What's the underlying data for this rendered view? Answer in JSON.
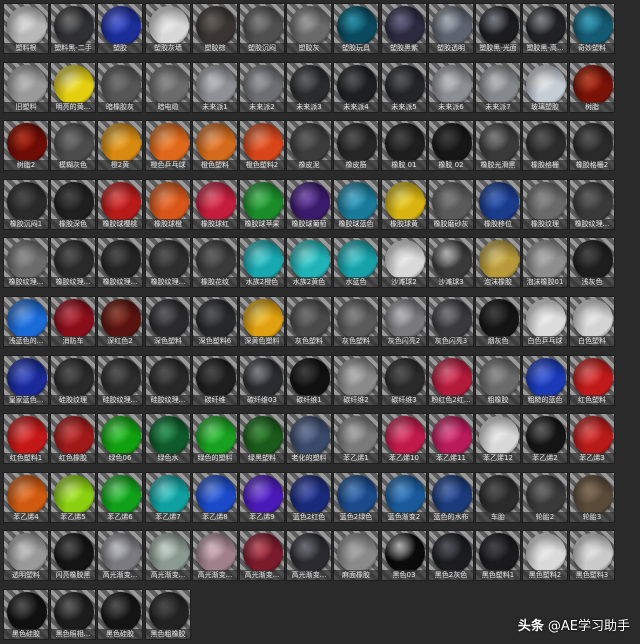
{
  "watermark": {
    "brand": "头条",
    "account": "@AE学习助手"
  },
  "materials": [
    {
      "label": "塑料根",
      "color": "#b8b8b8",
      "hl": "#ffffff"
    },
    {
      "label": "塑料黑-二手",
      "color": "#2f3032",
      "hl": "#8a8a8a"
    },
    {
      "label": "塑胶",
      "color": "#1c2e9a",
      "hl": "#6f82ff"
    },
    {
      "label": "塑胶灰墙",
      "color": "#d8d8d8",
      "hl": "#ffffff"
    },
    {
      "label": "塑胶棕",
      "color": "#3a3532",
      "hl": "#7d7570"
    },
    {
      "label": "塑胶沉闷",
      "color": "#505050",
      "hl": "#a0a0a0"
    },
    {
      "label": "塑胶灰",
      "color": "#6a6a6a",
      "hl": "#c0c0c0"
    },
    {
      "label": "塑胶玩具",
      "color": "#0b4a5e",
      "hl": "#3ab6d2"
    },
    {
      "label": "塑胶黑紫",
      "color": "#2b2a3e",
      "hl": "#8582a8"
    },
    {
      "label": "塑胶透明",
      "color": "#5d6470",
      "hl": "#cfd6e0"
    },
    {
      "label": "塑胶黑-光面",
      "color": "#1a1c1e",
      "hl": "#9aa0a8"
    },
    {
      "label": "塑胶黑-高...",
      "color": "#202224",
      "hl": "#a5a8ac"
    },
    {
      "label": "奇妙塑料",
      "color": "#155a73",
      "hl": "#4cc6e6"
    },
    {
      "label": "旧塑料",
      "color": "#9a9a9a",
      "hl": "#dadada"
    },
    {
      "label": "明亮的黄...",
      "color": "#e3cf10",
      "hl": "#fff5a0"
    },
    {
      "label": "暗橡胶灰",
      "color": "#565656",
      "hl": "#8c8c8c"
    },
    {
      "label": "暗电缆",
      "color": "#6b6b6b",
      "hl": "#a8a8a8"
    },
    {
      "label": "未来派1",
      "color": "#8e9095",
      "hl": "#dfe2e6"
    },
    {
      "label": "未来派2",
      "color": "#6c6e72",
      "hl": "#bfc2c6"
    },
    {
      "label": "未来派3",
      "color": "#2a2b2d",
      "hl": "#7a7c80"
    },
    {
      "label": "未来派4",
      "color": "#1e1f21",
      "hl": "#6a6c70"
    },
    {
      "label": "未来派5",
      "color": "#242527",
      "hl": "#6e7073"
    },
    {
      "label": "未来派6",
      "color": "#8b8e92",
      "hl": "#e6e8ea"
    },
    {
      "label": "未来派7",
      "color": "#85888c",
      "hl": "#e0e2e4"
    },
    {
      "label": "玻璃塑胶",
      "color": "#c4ccd4",
      "hl": "#ffffff"
    },
    {
      "label": "树脂",
      "color": "#7a1208",
      "hl": "#e25a3a"
    },
    {
      "label": "树脂2",
      "color": "#6e0c06",
      "hl": "#d8442a"
    },
    {
      "label": "模糊灰色",
      "color": "#4c4c4c",
      "hl": "#8e8e8e"
    },
    {
      "label": "橙2黄",
      "color": "#d88a10",
      "hl": "#ffd070"
    },
    {
      "label": "橙色乒乓球",
      "color": "#e0681a",
      "hl": "#ffb070"
    },
    {
      "label": "橙色塑料",
      "color": "#d46a1c",
      "hl": "#ffb47a"
    },
    {
      "label": "橙色塑料2",
      "color": "#d8451a",
      "hl": "#ff9a70"
    },
    {
      "label": "橡皮泥",
      "color": "#3c3c3c",
      "hl": "#7a7a7a"
    },
    {
      "label": "橡皮筋",
      "color": "#262626",
      "hl": "#6a6a6a"
    },
    {
      "label": "橡胶 01",
      "color": "#1e1e1e",
      "hl": "#5a5a5a"
    },
    {
      "label": "橡胶 02",
      "color": "#161616",
      "hl": "#4e4e4e"
    },
    {
      "label": "橡胶光滑黑",
      "color": "#3a3a3a",
      "hl": "#a0a0a0"
    },
    {
      "label": "橡胶格栅",
      "color": "#2c2c2c",
      "hl": "#707070"
    },
    {
      "label": "橡胶格栅2",
      "color": "#2a2a2a",
      "hl": "#6e6e6e"
    },
    {
      "label": "橡胶沉闷1",
      "color": "#2a2a2a",
      "hl": "#5e5e5e"
    },
    {
      "label": "橡胶深色",
      "color": "#1f1f1f",
      "hl": "#5a5a5a"
    },
    {
      "label": "橡胶球樱桃",
      "color": "#b81a1a",
      "hl": "#ff7070"
    },
    {
      "label": "橡胶球橙",
      "color": "#d8561a",
      "hl": "#ff9d66"
    },
    {
      "label": "橡胶球红",
      "color": "#c41c3c",
      "hl": "#ff7a90"
    },
    {
      "label": "橡胶球苹果",
      "color": "#1a8c2a",
      "hl": "#70e080"
    },
    {
      "label": "橡胶球葡萄",
      "color": "#3a1a6a",
      "hl": "#9a70d8"
    },
    {
      "label": "橡胶球蓝色",
      "color": "#1a7a9a",
      "hl": "#70d0f0"
    },
    {
      "label": "橡胶球黄",
      "color": "#d8b410",
      "hl": "#fff070"
    },
    {
      "label": "橡胶磨砂灰",
      "color": "#5a5a5a",
      "hl": "#9a9a9a"
    },
    {
      "label": "橡胶移位",
      "color": "#1a3a8a",
      "hl": "#5a86e0"
    },
    {
      "label": "橡胶纹理",
      "color": "#6a6a6a",
      "hl": "#aaaaaa"
    },
    {
      "label": "橡胶纹理...",
      "color": "#3a3a3a",
      "hl": "#7a7a7a"
    },
    {
      "label": "橡胶纹理...",
      "color": "#6c6c6c",
      "hl": "#b0b0b0"
    },
    {
      "label": "橡胶纹理...",
      "color": "#2a2a2a",
      "hl": "#6a6a6a"
    },
    {
      "label": "橡胶纹理...",
      "color": "#242424",
      "hl": "#646464"
    },
    {
      "label": "橡胶纹理...",
      "color": "#2e2e2e",
      "hl": "#6e6e6e"
    },
    {
      "label": "橡胶花纹",
      "color": "#3a3a3a",
      "hl": "#7e7e7e"
    },
    {
      "label": "水族2橙色",
      "color": "#18a8b0",
      "hl": "#80f0f0"
    },
    {
      "label": "水族2黄色",
      "color": "#20b4b8",
      "hl": "#90f4f0"
    },
    {
      "label": "水蓝色",
      "color": "#16a0a8",
      "hl": "#7aeaf0"
    },
    {
      "label": "沙滩球2",
      "color": "#d8d8d8",
      "hl": "#ffffff"
    },
    {
      "label": "沙滩球3",
      "color": "#3a3a3a",
      "hl": "#e0e0e0"
    },
    {
      "label": "泡沫橡胶",
      "color": "#b89a3a",
      "hl": "#f0dc90"
    },
    {
      "label": "泡沫橡胶01",
      "color": "#8e8e8e",
      "hl": "#d0d0d0"
    },
    {
      "label": "浅灰色",
      "color": "#1e1e1e",
      "hl": "#5a5a5a"
    },
    {
      "label": "浅蓝色的...",
      "color": "#1a6ad8",
      "hl": "#7ab4ff"
    },
    {
      "label": "消防车",
      "color": "#8a0e1a",
      "hl": "#e05a6a"
    },
    {
      "label": "深红色2",
      "color": "#5a1410",
      "hl": "#b05a4a"
    },
    {
      "label": "深色塑料",
      "color": "#2a2a2c",
      "hl": "#7a7a7e"
    },
    {
      "label": "深色塑料6",
      "color": "#26282a",
      "hl": "#6e7074"
    },
    {
      "label": "深黄色塑料",
      "color": "#e0a010",
      "hl": "#ffe070"
    },
    {
      "label": "灰色塑料",
      "color": "#4a4a4a",
      "hl": "#8e8e8e"
    },
    {
      "label": "灰色塑料",
      "color": "#5a5a5a",
      "hl": "#a4a4a4"
    },
    {
      "label": "灰色闪亮2",
      "color": "#7a7a7e",
      "hl": "#e0e0e4"
    },
    {
      "label": "灰色闪亮3",
      "color": "#3a3a3e",
      "hl": "#9c9ca0"
    },
    {
      "label": "烟灰色",
      "color": "#141414",
      "hl": "#525252"
    },
    {
      "label": "白色乒乓球",
      "color": "#dcdcdc",
      "hl": "#ffffff"
    },
    {
      "label": "白色塑料",
      "color": "#d4d4d4",
      "hl": "#ffffff"
    },
    {
      "label": "皇家蓝色...",
      "color": "#1a2a9a",
      "hl": "#6a80f0"
    },
    {
      "label": "硅胶纹理",
      "color": "#2a2a2a",
      "hl": "#6a6a6a"
    },
    {
      "label": "硅胶纹理...",
      "color": "#2c2c2c",
      "hl": "#6c6c6c"
    },
    {
      "label": "硅胶纹理...",
      "color": "#282828",
      "hl": "#686868"
    },
    {
      "label": "碳纤维",
      "color": "#1e1e1e",
      "hl": "#5e5e5e"
    },
    {
      "label": "碳纤维03",
      "color": "#2a2c30",
      "hl": "#a0a4aa"
    },
    {
      "label": "碳纤维1",
      "color": "#101010",
      "hl": "#505050"
    },
    {
      "label": "碳纤维2",
      "color": "#8a8a8a",
      "hl": "#dadada"
    },
    {
      "label": "碳纤维3",
      "color": "#2a2a2a",
      "hl": "#6a6a6a"
    },
    {
      "label": "粉红色2红...",
      "color": "#b41a3a",
      "hl": "#ff7a9a"
    },
    {
      "label": "粗橡胶",
      "color": "#6a6a6a",
      "hl": "#b0b0b0"
    },
    {
      "label": "粗糙的蓝色",
      "color": "#1a3ab8",
      "hl": "#6a8aff"
    },
    {
      "label": "红色塑料",
      "color": "#c01a1a",
      "hl": "#ff7a7a"
    },
    {
      "label": "红色塑料1",
      "color": "#c41818",
      "hl": "#ff7070"
    },
    {
      "label": "红色橡胶",
      "color": "#a01a1a",
      "hl": "#e86060"
    },
    {
      "label": "绿色06",
      "color": "#10a010",
      "hl": "#70f070"
    },
    {
      "label": "绿色水",
      "color": "#0e5a2a",
      "hl": "#4ac07a"
    },
    {
      "label": "绿色的塑料",
      "color": "#18a020",
      "hl": "#7af080"
    },
    {
      "label": "绿黑塑料",
      "color": "#1a5a1a",
      "hl": "#5ab05a"
    },
    {
      "label": "老化的塑料",
      "color": "#3a4a6a",
      "hl": "#8a9ac0"
    },
    {
      "label": "苯乙烯1",
      "color": "#7a7a7a",
      "hl": "#d0d0d0"
    },
    {
      "label": "苯乙烯10",
      "color": "#c01a4a",
      "hl": "#ff7aa0"
    },
    {
      "label": "苯乙烯11",
      "color": "#b81a5a",
      "hl": "#ff7ab0"
    },
    {
      "label": "苯乙烯12",
      "color": "#d8d8d8",
      "hl": "#ffffff"
    },
    {
      "label": "苯乙烯2",
      "color": "#141414",
      "hl": "#7a7a7a"
    },
    {
      "label": "苯乙烯3",
      "color": "#b81a1a",
      "hl": "#ff7070"
    },
    {
      "label": "苯乙烯4",
      "color": "#d05a10",
      "hl": "#ffa060"
    },
    {
      "label": "苯乙烯5",
      "color": "#8ad010",
      "hl": "#d8ff80"
    },
    {
      "label": "苯乙烯6",
      "color": "#10a01a",
      "hl": "#80f08a"
    },
    {
      "label": "苯乙烯7",
      "color": "#10a0a0",
      "hl": "#80f0f0"
    },
    {
      "label": "苯乙烯8",
      "color": "#1a4ac8",
      "hl": "#7aa0ff"
    },
    {
      "label": "苯乙烯9",
      "color": "#4a1ab8",
      "hl": "#a07aff"
    },
    {
      "label": "蓝色2红色",
      "color": "#1a2a7a",
      "hl": "#6a7ad0"
    },
    {
      "label": "蓝色2绿色",
      "color": "#1a4a8a",
      "hl": "#6aa0e0"
    },
    {
      "label": "蓝色渐变2",
      "color": "#1a5a9a",
      "hl": "#6ab0f0"
    },
    {
      "label": "蓝色的水布",
      "color": "#1a3a7a",
      "hl": "#6a8ad0"
    },
    {
      "label": "车胎",
      "color": "#2a2a2a",
      "hl": "#6a6a6a"
    },
    {
      "label": "轮胎2",
      "color": "#3a3a3a",
      "hl": "#8a8a8a"
    },
    {
      "label": "轮胎3",
      "color": "#5a4a3a",
      "hl": "#a08a70"
    },
    {
      "label": "透明塑料",
      "color": "#9a9a9a",
      "hl": "#e8e8e8"
    },
    {
      "label": "闪亮橡胶黑",
      "color": "#141414",
      "hl": "#6a6a6a"
    },
    {
      "label": "高光渐变...",
      "color": "#7a7a80",
      "hl": "#e8e8f0"
    },
    {
      "label": "高光渐变...",
      "color": "#8a9a90",
      "hl": "#f0fff4"
    },
    {
      "label": "高光渐变...",
      "color": "#a0808a",
      "hl": "#ffe0ea"
    },
    {
      "label": "高光渐变...",
      "color": "#7a1a2a",
      "hl": "#e87080"
    },
    {
      "label": "高光渐变...",
      "color": "#2a2a30",
      "hl": "#8a8a96"
    },
    {
      "label": "麻面橡胶",
      "color": "#8a8a8a",
      "hl": "#c8c8c8"
    },
    {
      "label": "黑色03",
      "color": "#0a0a0a",
      "hl": "#e0e0e0"
    },
    {
      "label": "黑色2灰色",
      "color": "#1a1c20",
      "hl": "#6a6e76"
    },
    {
      "label": "黑色塑料1",
      "color": "#1a1a1c",
      "hl": "#5a5a5e"
    },
    {
      "label": "黑色塑料2",
      "color": "#dadada",
      "hl": "#ffffff"
    },
    {
      "label": "黑色塑料3",
      "color": "#cacaca",
      "hl": "#ffffff"
    },
    {
      "label": "黑色硅胶",
      "color": "#101010",
      "hl": "#6a6a6a"
    },
    {
      "label": "黑色照相...",
      "color": "#1c1c1c",
      "hl": "#7a7a7a"
    },
    {
      "label": "黑色硅胶",
      "color": "#141414",
      "hl": "#6a6a6a"
    },
    {
      "label": "黑色粗橡胶",
      "color": "#222222",
      "hl": "#5e5e5e"
    }
  ]
}
